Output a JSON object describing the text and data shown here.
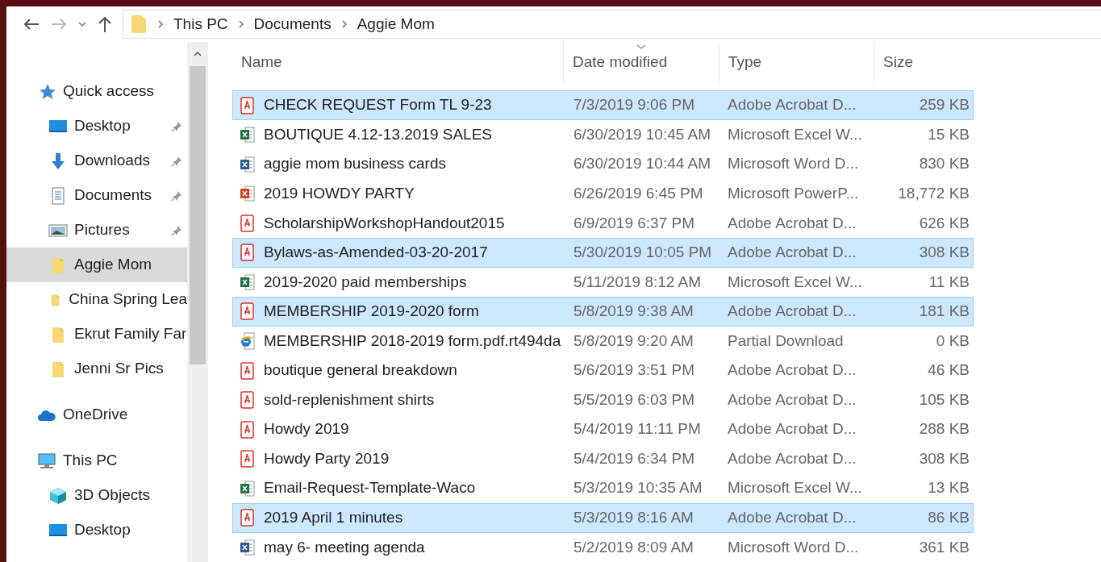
{
  "breadcrumb": [
    "This PC",
    "Documents",
    "Aggie Mom"
  ],
  "sidebar": {
    "quick_access": "Quick access",
    "items": [
      {
        "label": "Desktop",
        "kind": "desktop",
        "pinned": true,
        "selected": false
      },
      {
        "label": "Downloads",
        "kind": "downloads",
        "pinned": true,
        "selected": false
      },
      {
        "label": "Documents",
        "kind": "documents",
        "pinned": true,
        "selected": false
      },
      {
        "label": "Pictures",
        "kind": "pictures",
        "pinned": true,
        "selected": false
      },
      {
        "label": "Aggie Mom",
        "kind": "folder",
        "pinned": false,
        "selected": true
      },
      {
        "label": "China Spring Lea",
        "kind": "folder",
        "pinned": false,
        "selected": false
      },
      {
        "label": "Ekrut Family Far",
        "kind": "folder",
        "pinned": false,
        "selected": false
      },
      {
        "label": "Jenni Sr Pics",
        "kind": "folder",
        "pinned": false,
        "selected": false
      }
    ],
    "onedrive": "OneDrive",
    "this_pc": "This PC",
    "pc_items": [
      {
        "label": "3D Objects",
        "kind": "objects3d"
      },
      {
        "label": "Desktop",
        "kind": "desktop"
      }
    ]
  },
  "table": {
    "columns": [
      "Name",
      "Date modified",
      "Type",
      "Size"
    ],
    "rows": [
      {
        "name": "CHECK REQUEST Form TL 9-23",
        "date": "7/3/2019 9:06 PM",
        "type": "Adobe Acrobat D...",
        "size": "259 KB",
        "kind": "pdf",
        "selected": true
      },
      {
        "name": "BOUTIQUE 4.12-13.2019 SALES",
        "date": "6/30/2019 10:45 AM",
        "type": "Microsoft Excel W...",
        "size": "15 KB",
        "kind": "excel",
        "selected": false
      },
      {
        "name": "aggie mom business cards",
        "date": "6/30/2019 10:44 AM",
        "type": "Microsoft Word D...",
        "size": "830 KB",
        "kind": "word",
        "selected": false
      },
      {
        "name": "2019 HOWDY PARTY",
        "date": "6/26/2019 6:45 PM",
        "type": "Microsoft PowerP...",
        "size": "18,772 KB",
        "kind": "powerpoint",
        "selected": false
      },
      {
        "name": "ScholarshipWorkshopHandout2015",
        "date": "6/9/2019 6:37 PM",
        "type": "Adobe Acrobat D...",
        "size": "626 KB",
        "kind": "pdf",
        "selected": false
      },
      {
        "name": "Bylaws-as-Amended-03-20-2017",
        "date": "5/30/2019 10:05 PM",
        "type": "Adobe Acrobat D...",
        "size": "308 KB",
        "kind": "pdf",
        "selected": true
      },
      {
        "name": "2019-2020 paid memberships",
        "date": "5/11/2019 8:12 AM",
        "type": "Microsoft Excel W...",
        "size": "11 KB",
        "kind": "excel",
        "selected": false
      },
      {
        "name": "MEMBERSHIP 2019-2020 form",
        "date": "5/8/2019 9:38 AM",
        "type": "Adobe Acrobat D...",
        "size": "181 KB",
        "kind": "pdf",
        "selected": true
      },
      {
        "name": "MEMBERSHIP 2018-2019 form.pdf.rt494da",
        "date": "5/8/2019 9:20 AM",
        "type": "Partial Download",
        "size": "0 KB",
        "kind": "partial",
        "selected": false
      },
      {
        "name": "boutique general breakdown",
        "date": "5/6/2019 3:51 PM",
        "type": "Adobe Acrobat D...",
        "size": "46 KB",
        "kind": "pdf",
        "selected": false
      },
      {
        "name": "sold-replenishment shirts",
        "date": "5/5/2019 6:03 PM",
        "type": "Adobe Acrobat D...",
        "size": "105 KB",
        "kind": "pdf",
        "selected": false
      },
      {
        "name": "Howdy 2019",
        "date": "5/4/2019 11:11 PM",
        "type": "Adobe Acrobat D...",
        "size": "288 KB",
        "kind": "pdf",
        "selected": false
      },
      {
        "name": "Howdy Party 2019",
        "date": "5/4/2019 6:34 PM",
        "type": "Adobe Acrobat D...",
        "size": "308 KB",
        "kind": "pdf",
        "selected": false
      },
      {
        "name": "Email-Request-Template-Waco",
        "date": "5/3/2019 10:35 AM",
        "type": "Microsoft Excel W...",
        "size": "13 KB",
        "kind": "excel",
        "selected": false
      },
      {
        "name": "2019 April 1 minutes",
        "date": "5/3/2019 8:16 AM",
        "type": "Adobe Acrobat D...",
        "size": "86 KB",
        "kind": "pdf",
        "selected": true
      },
      {
        "name": "may 6- meeting agenda",
        "date": "5/2/2019 8:09 AM",
        "type": "Microsoft Word D...",
        "size": "361 KB",
        "kind": "word",
        "selected": false
      }
    ]
  }
}
